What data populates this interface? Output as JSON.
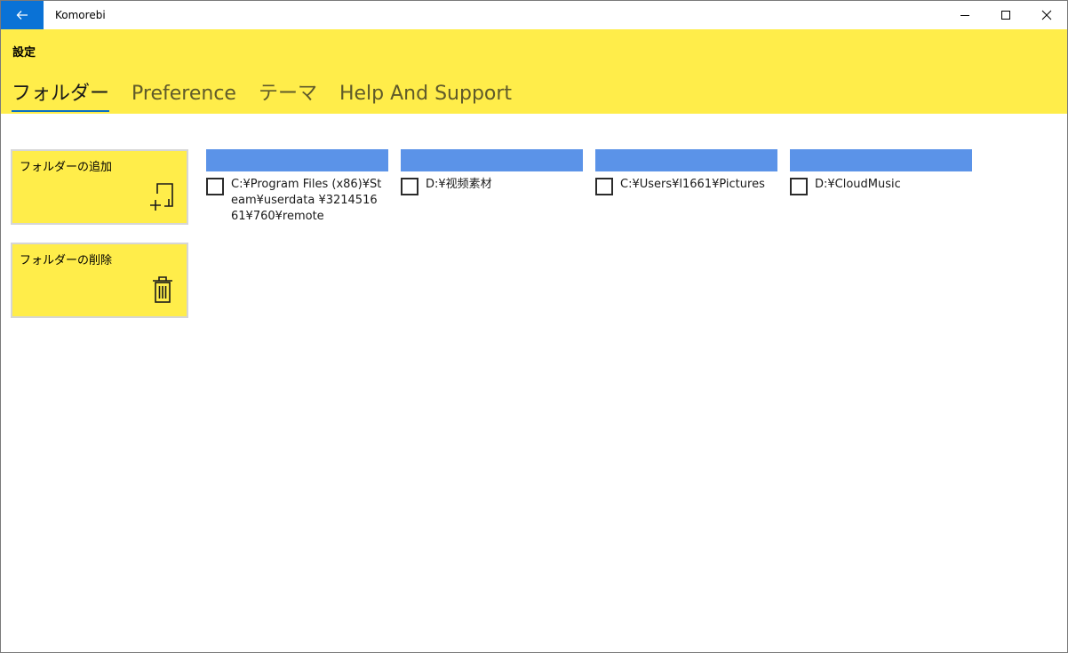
{
  "window": {
    "app_title": "Komorebi"
  },
  "header": {
    "title": "設定",
    "tabs": [
      {
        "label": "フォルダー",
        "active": true
      },
      {
        "label": "Preference",
        "active": false
      },
      {
        "label": "テーマ",
        "active": false
      },
      {
        "label": "Help And Support",
        "active": false
      }
    ]
  },
  "actions": {
    "add_label": "フォルダーの追加",
    "delete_label": "フォルダーの削除"
  },
  "folders": [
    {
      "path": "C:¥Program Files (x86)¥Steam¥userdata ¥321451661¥760¥remote",
      "checked": false
    },
    {
      "path": "D:¥视频素材",
      "checked": false
    },
    {
      "path": "C:¥Users¥l1661¥Pictures",
      "checked": false
    },
    {
      "path": "D:¥CloudMusic",
      "checked": false
    }
  ],
  "colors": {
    "accent_yellow": "#ffed4a",
    "back_button_blue": "#0a72d6",
    "folder_bar_blue": "#5b93e8",
    "tab_underline": "#0a6fc4"
  },
  "icons": {
    "back": "arrow-left-icon",
    "minimize": "minimize-icon",
    "maximize": "maximize-icon",
    "close": "close-icon",
    "add_folder": "add-folder-icon",
    "delete_folder": "trash-icon"
  }
}
